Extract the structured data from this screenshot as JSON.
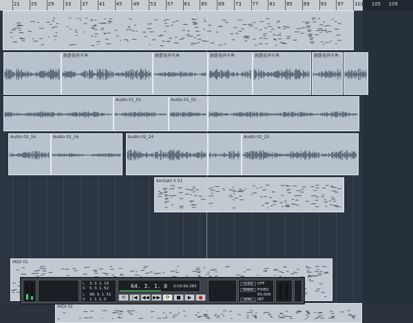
{
  "ruler": {
    "bars": [
      "21",
      "25",
      "29",
      "33",
      "37",
      "41",
      "45",
      "49",
      "53",
      "57",
      "61",
      "65",
      "69",
      "73",
      "77",
      "81",
      "85",
      "89",
      "93",
      "97",
      "101",
      "105",
      "109"
    ]
  },
  "clips": [
    {
      "name": "",
      "kind": "midi"
    },
    {
      "name": "",
      "kind": "audio"
    },
    {
      "name": "颜是花开千声",
      "kind": "audio"
    },
    {
      "name": "颜是花开千声",
      "kind": "audio"
    },
    {
      "name": "颜是花开千声",
      "kind": "audio"
    },
    {
      "name": "颜是花开千声",
      "kind": "audio"
    },
    {
      "name": "颜是花开千声",
      "kind": "audio"
    },
    {
      "name": "",
      "kind": "audio"
    },
    {
      "name": "Audio 01_01",
      "kind": "audio"
    },
    {
      "name": "Audio 01_02",
      "kind": "audio"
    },
    {
      "name": "",
      "kind": "audio"
    },
    {
      "name": "Audio 02_14",
      "kind": "audio"
    },
    {
      "name": "Audio 02_16",
      "kind": "audio"
    },
    {
      "name": "Audio 02_24",
      "kind": "audio"
    },
    {
      "name": "",
      "kind": "audio"
    },
    {
      "name": "Audio 02_25",
      "kind": "audio"
    },
    {
      "name": "Kontakt 5 01",
      "kind": "midi"
    },
    {
      "name": "MIDI 01",
      "kind": "midi"
    },
    {
      "name": "MIDI 02",
      "kind": "midi"
    }
  ],
  "transport": {
    "mode_lines": [
      "",
      "",
      "",
      ""
    ],
    "left_locator": [
      "3. 3. 1. 19",
      "5. 3. 1. 52",
      "98. 3. 1. 51",
      "1. 1. 1. 0"
    ],
    "loc_labels": [
      "L",
      "R",
      "L",
      "R"
    ],
    "position_bars": "64. 3. 1.   0",
    "position_time": "0:03:56.383",
    "click": "CLICK",
    "click_state": "OFF",
    "tempo": "TEMPO",
    "tempo_mode": "FIXED",
    "tempo_value": "65.000",
    "sync": "SYNC",
    "sync_state": "INT.",
    "buttons": {
      "cycle": "⟲",
      "rewind": "◀◀",
      "forward": "▶▶",
      "stop": "■",
      "play": "▶",
      "record": "●",
      "tostart": "|◀",
      "loop": "⟳"
    }
  },
  "colors": {
    "background": "#2c3642",
    "clip": "#b7c2cd",
    "ruler": "#c9cdd2",
    "transport": "#3c4147",
    "meter": "#3fd068"
  }
}
